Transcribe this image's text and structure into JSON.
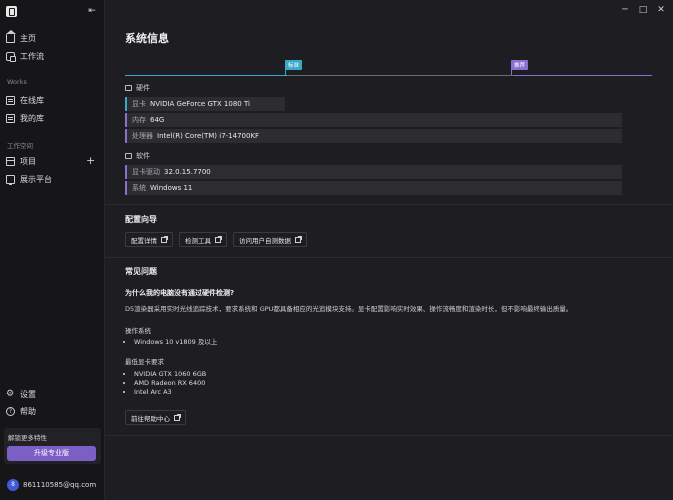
{
  "sidebar": {
    "nav_main": [
      {
        "label": "主页",
        "icon": "home-icon"
      },
      {
        "label": "工作流",
        "icon": "workflow-icon"
      }
    ],
    "works_label": "Works",
    "nav_works": [
      {
        "label": "在线库",
        "icon": "online-library-icon"
      },
      {
        "label": "我的库",
        "icon": "my-library-icon"
      }
    ],
    "workspace_label": "工作空间",
    "nav_workspace": [
      {
        "label": "项目",
        "icon": "project-icon"
      },
      {
        "label": "展示平台",
        "icon": "showcase-icon"
      }
    ],
    "bottom": [
      {
        "label": "设置",
        "icon": "gear-icon"
      },
      {
        "label": "帮助",
        "icon": "help-icon"
      }
    ],
    "unlock_text": "解锁更多特性",
    "upgrade_button": "升级专业版",
    "user": {
      "avatar_letter": "8",
      "email": "861110585@qq.com"
    }
  },
  "window": {
    "minimize": "─",
    "maximize": "□",
    "close": "✕"
  },
  "page": {
    "title": "系统信息",
    "timeline": {
      "marker_1": "标准",
      "marker_2": "推荐"
    },
    "hardware": {
      "heading": "硬件",
      "rows": [
        {
          "key": "显卡",
          "value": "NVIDIA GeForce GTX 1080 Ti"
        },
        {
          "key": "内存",
          "value": "64G"
        },
        {
          "key": "处理器",
          "value": "Intel(R) Core(TM) i7-14700KF"
        }
      ]
    },
    "software": {
      "heading": "软件",
      "rows": [
        {
          "key": "显卡驱动",
          "value": "32.0.15.7700"
        },
        {
          "key": "系统",
          "value": "Windows 11"
        }
      ]
    },
    "config_guide": {
      "title": "配置向导",
      "buttons": [
        "配置详情",
        "检测工具",
        "访问用户自测数据"
      ]
    },
    "faq": {
      "title": "常见问题",
      "question": "为什么我的电脑没有通过硬件检测?",
      "answer": "D5渲染器采用实时光线追踪技术，要求系统和 GPU都具备相应的光追模块支持。显卡配置影响实时效果、操作流畅度和渲染时长，但不影响最终输出质量。",
      "os_label": "操作系统",
      "os_items": [
        "Windows 10 v1809 及以上"
      ],
      "gpu_label": "最低显卡要求",
      "gpu_items": [
        "NVIDIA GTX 1060 6GB",
        "AMD Radeon RX 6400",
        "Intel Arc A3"
      ],
      "help_button": "前往帮助中心"
    }
  }
}
